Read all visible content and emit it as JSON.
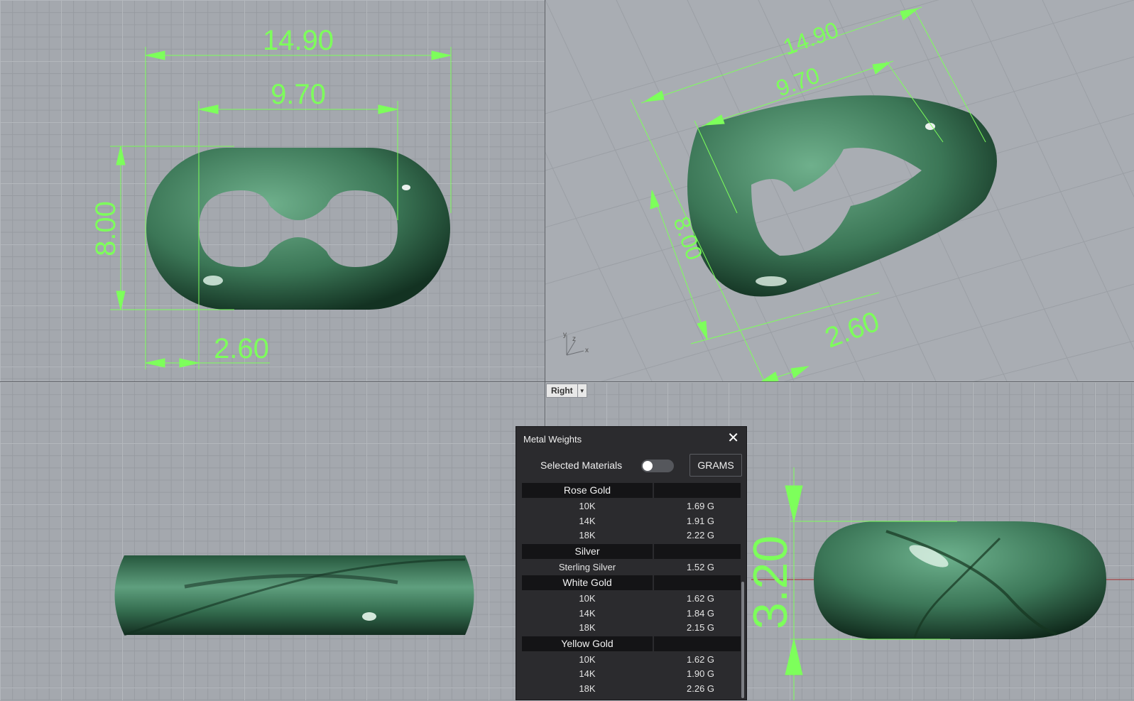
{
  "viewports": {
    "active_label": "Right"
  },
  "dimensions": {
    "top_view": {
      "outer_width": "14.90",
      "inner_width": "9.70",
      "height": "8.00",
      "wire": "2.60"
    },
    "perspective_view": {
      "outer_width": "14.90",
      "inner_width": "9.70",
      "height": "8.00",
      "wire": "2.60"
    },
    "right_view": {
      "thickness": "3.20"
    }
  },
  "model": {
    "color": "#3d7a5a"
  },
  "panel": {
    "title": "Metal Weights",
    "close_symbol": "✕",
    "selected_materials_label": "Selected Materials",
    "selected_materials_on": false,
    "units_button": "GRAMS",
    "groups": [
      {
        "name": "Rose Gold",
        "items": [
          {
            "karat": "10K",
            "weight": "1.69 G"
          },
          {
            "karat": "14K",
            "weight": "1.91 G"
          },
          {
            "karat": "18K",
            "weight": "2.22 G"
          }
        ]
      },
      {
        "name": "Silver",
        "items": [
          {
            "karat": "Sterling Silver",
            "weight": "1.52 G"
          }
        ]
      },
      {
        "name": "White Gold",
        "items": [
          {
            "karat": "10K",
            "weight": "1.62 G"
          },
          {
            "karat": "14K",
            "weight": "1.84 G"
          },
          {
            "karat": "18K",
            "weight": "2.15 G"
          }
        ]
      },
      {
        "name": "Yellow Gold",
        "items": [
          {
            "karat": "10K",
            "weight": "1.62 G"
          },
          {
            "karat": "14K",
            "weight": "1.90 G"
          },
          {
            "karat": "18K",
            "weight": "2.26 G"
          }
        ]
      }
    ]
  },
  "axis_labels": {
    "x": "x",
    "y": "y",
    "z": "z"
  },
  "colors": {
    "dimension": "#7dff5b",
    "viewport_bg": "#a4a8ae",
    "panel_bg": "#2b2b2e"
  }
}
